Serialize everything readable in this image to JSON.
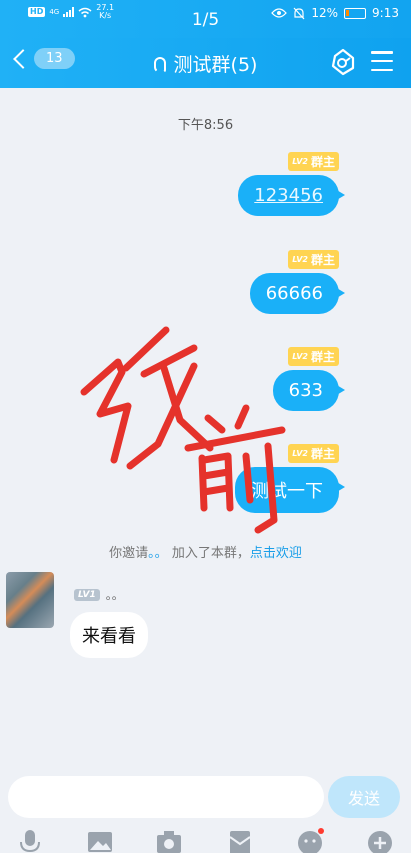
{
  "statusbar": {
    "hd": "HD",
    "net": "4G",
    "speed_value": "27.1",
    "speed_unit": "K/s",
    "page_indicator": "1/5",
    "battery": "12%",
    "clock": "9:13"
  },
  "header": {
    "unread_count": "13",
    "title": "测试群(5)"
  },
  "chat": {
    "timestamp": "下午8:56",
    "sent_messages": [
      {
        "badge_level": "LV2",
        "badge_role": "群主",
        "text": "123456"
      },
      {
        "badge_level": "LV2",
        "badge_role": "群主",
        "text": "66666"
      },
      {
        "badge_level": "LV2",
        "badge_role": "群主",
        "text": "633"
      },
      {
        "badge_level": "LV2",
        "badge_role": "群主",
        "text": "测试一下"
      }
    ],
    "system_notice": {
      "prefix": "你邀请",
      "invitee": "。。",
      "middle": "加入了本群，",
      "action": "点击欢迎"
    },
    "received_message": {
      "badge_level": "LV1",
      "nickname": "。。",
      "text": "来看看"
    }
  },
  "overlay": {
    "stamp_text": "改前",
    "stamp_color": "#e5322b"
  },
  "composer": {
    "input_value": "",
    "send_label": "发送"
  },
  "toolbar": {
    "items": [
      "mic-icon",
      "image-icon",
      "camera-icon",
      "red-packet-icon",
      "emoji-icon",
      "plus-icon"
    ]
  },
  "colors": {
    "brand": "#12a4f0",
    "bubble": "#1ab0f8",
    "owner_badge": "#ffd452"
  }
}
